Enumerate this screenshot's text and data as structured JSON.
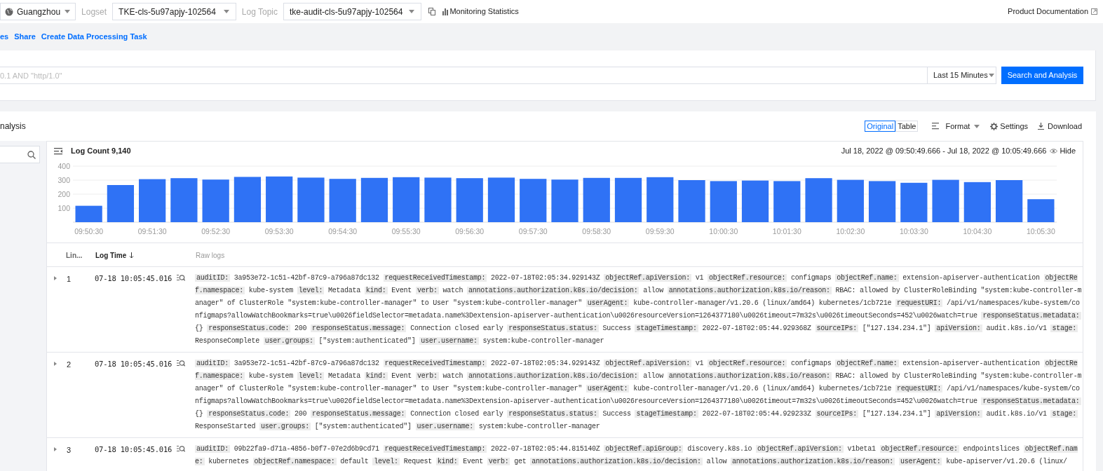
{
  "top_bar": {
    "region": "Guangzhou",
    "logset_label": "Logset",
    "logset": "TKE-cls-5u97apjy-102564",
    "topic_label": "Log Topic",
    "topic": "tke-audit-cls-5u97apjy-102564",
    "monitoring": "Monitoring Statistics",
    "docs": "Product Documentation"
  },
  "actions": [
    "es",
    "Share",
    "Create Data Processing Task"
  ],
  "search": {
    "placeholder": "0.1 AND \"http/1.0\"",
    "time_range": "Last 15 Minutes",
    "button": "Search and Analysis"
  },
  "results": {
    "title": "nalysis",
    "view_tabs": [
      {
        "label": "Original",
        "selected": true
      },
      {
        "label": "Table",
        "selected": false
      }
    ],
    "tools": [
      {
        "kind": "format",
        "label": "Format"
      },
      {
        "kind": "settings",
        "label": "Settings"
      },
      {
        "kind": "download",
        "label": "Download"
      }
    ],
    "log_count": "Log Count 9,140",
    "time_span": "Jul 18, 2022 @ 09:50:49.666 - Jul 18, 2022 @ 10:05:49.666",
    "hide": "Hide",
    "chart_data": {
      "type": "bar",
      "categories": [
        "09:50:30",
        null,
        "09:51:30",
        null,
        "09:52:30",
        null,
        "09:53:30",
        null,
        "09:54:30",
        null,
        "09:55:30",
        null,
        "09:56:30",
        null,
        "09:57:30",
        null,
        "09:58:30",
        null,
        "09:59:30",
        null,
        "10:00:30",
        null,
        "10:01:30",
        null,
        "10:02:30",
        null,
        "10:03:30",
        null,
        "10:04:30",
        null,
        "10:05:30"
      ],
      "series": [
        {
          "color": "#2f72f5",
          "values": [
            117,
            265,
            307,
            314,
            304,
            323,
            326,
            318,
            309,
            316,
            321,
            318,
            314,
            318,
            309,
            304,
            316,
            316,
            321,
            300,
            293,
            297,
            293,
            314,
            302,
            293,
            281,
            302,
            286,
            300,
            164
          ]
        }
      ],
      "ylim": [
        0,
        400
      ],
      "yticks": [
        100,
        200,
        300,
        400
      ],
      "grid": true
    },
    "columns": [
      "Lin...",
      "Log Time",
      "Raw logs"
    ],
    "rows": [
      {
        "number": "1",
        "time": "07-18 10:05:45.016",
        "fields": [
          {
            "key": "auditID:",
            "value": "3a953e72-1c51-42bf-87c9-a796a87dc132"
          },
          {
            "key": "requestReceivedTimestamp:",
            "value": "2022-07-18T02:05:34.929143Z"
          },
          {
            "key": "objectRef.apiVersion:",
            "value": "v1"
          },
          {
            "key": "objectRef.resource:",
            "value": "configmaps"
          },
          {
            "key": "objectRef.name:",
            "value": "extension-apiserver-authentication"
          },
          {
            "key": "objectRef.namespace:",
            "value": "kube-system"
          },
          {
            "key": "level:",
            "value": "Metadata"
          },
          {
            "key": "kind:",
            "value": "Event"
          },
          {
            "key": "verb:",
            "value": "watch"
          },
          {
            "key": "annotations.authorization.k8s.io/decision:",
            "value": "allow"
          },
          {
            "key": "annotations.authorization.k8s.io/reason:",
            "value": "RBAC: allowed by ClusterRoleBinding \"system:kube-controller-manager\" of ClusterRole \"system:kube-controller-manager\" to User \"system:kube-controller-manager\""
          },
          {
            "key": "userAgent:",
            "value": "kube-controller-manager/v1.20.6 (linux/amd64) kubernetes/1cb721e"
          },
          {
            "key": "requestURI:",
            "value": "/api/v1/namespaces/kube-system/configmaps?allowWatchBookmarks=true\\u0026fieldSelector=metadata.name%3Dextension-apiserver-authentication\\u0026resourceVersion=1264377180\\u0026timeout=7m32s\\u0026timeoutSeconds=452\\u0026watch=true"
          },
          {
            "key": "responseStatus.metadata:",
            "value": "{}"
          },
          {
            "key": "responseStatus.code:",
            "value": "200"
          },
          {
            "key": "responseStatus.message:",
            "value": "Connection closed early"
          },
          {
            "key": "responseStatus.status:",
            "value": "Success"
          },
          {
            "key": "stageTimestamp:",
            "value": "2022-07-18T02:05:44.929368Z"
          },
          {
            "key": "sourceIPs:",
            "value": "[\"127.134.234.1\"]"
          },
          {
            "key": "apiVersion:",
            "value": "audit.k8s.io/v1"
          },
          {
            "key": "stage:",
            "value": "ResponseComplete"
          },
          {
            "key": "user.groups:",
            "value": "[\"system:authenticated\"]"
          },
          {
            "key": "user.username:",
            "value": "system:kube-controller-manager"
          }
        ]
      },
      {
        "number": "2",
        "time": "07-18 10:05:45.016",
        "fields": [
          {
            "key": "auditID:",
            "value": "3a953e72-1c51-42bf-87c9-a796a87dc132"
          },
          {
            "key": "requestReceivedTimestamp:",
            "value": "2022-07-18T02:05:34.929143Z"
          },
          {
            "key": "objectRef.apiVersion:",
            "value": "v1"
          },
          {
            "key": "objectRef.resource:",
            "value": "configmaps"
          },
          {
            "key": "objectRef.name:",
            "value": "extension-apiserver-authentication"
          },
          {
            "key": "objectRef.namespace:",
            "value": "kube-system"
          },
          {
            "key": "level:",
            "value": "Metadata"
          },
          {
            "key": "kind:",
            "value": "Event"
          },
          {
            "key": "verb:",
            "value": "watch"
          },
          {
            "key": "annotations.authorization.k8s.io/decision:",
            "value": "allow"
          },
          {
            "key": "annotations.authorization.k8s.io/reason:",
            "value": "RBAC: allowed by ClusterRoleBinding \"system:kube-controller-manager\" of ClusterRole \"system:kube-controller-manager\" to User \"system:kube-controller-manager\""
          },
          {
            "key": "userAgent:",
            "value": "kube-controller-manager/v1.20.6 (linux/amd64) kubernetes/1cb721e"
          },
          {
            "key": "requestURI:",
            "value": "/api/v1/namespaces/kube-system/configmaps?allowWatchBookmarks=true\\u0026fieldSelector=metadata.name%3Dextension-apiserver-authentication\\u0026resourceVersion=1264377180\\u0026timeout=7m32s\\u0026timeoutSeconds=452\\u0026watch=true"
          },
          {
            "key": "responseStatus.metadata:",
            "value": "{}"
          },
          {
            "key": "responseStatus.code:",
            "value": "200"
          },
          {
            "key": "responseStatus.message:",
            "value": "Connection closed early"
          },
          {
            "key": "responseStatus.status:",
            "value": "Success"
          },
          {
            "key": "stageTimestamp:",
            "value": "2022-07-18T02:05:44.929233Z"
          },
          {
            "key": "sourceIPs:",
            "value": "[\"127.134.234.1\"]"
          },
          {
            "key": "apiVersion:",
            "value": "audit.k8s.io/v1"
          },
          {
            "key": "stage:",
            "value": "ResponseStarted"
          },
          {
            "key": "user.groups:",
            "value": "[\"system:authenticated\"]"
          },
          {
            "key": "user.username:",
            "value": "system:kube-controller-manager"
          }
        ]
      },
      {
        "number": "3",
        "time": "07-18 10:05:45.016",
        "fields": [
          {
            "key": "auditID:",
            "value": "09b22fa9-d71a-4856-b0f7-07e2d6b9cd71"
          },
          {
            "key": "requestReceivedTimestamp:",
            "value": "2022-07-18T02:05:44.815140Z"
          },
          {
            "key": "objectRef.apiGroup:",
            "value": "discovery.k8s.io"
          },
          {
            "key": "objectRef.apiVersion:",
            "value": "v1beta1"
          },
          {
            "key": "objectRef.resource:",
            "value": "endpointslices"
          },
          {
            "key": "objectRef.name:",
            "value": "kubernetes"
          },
          {
            "key": "objectRef.namespace:",
            "value": "default"
          },
          {
            "key": "level:",
            "value": "Request"
          },
          {
            "key": "kind:",
            "value": "Event"
          },
          {
            "key": "verb:",
            "value": "get"
          },
          {
            "key": "annotations.authorization.k8s.io/decision:",
            "value": "allow"
          },
          {
            "key": "annotations.authorization.k8s.io/reason:"
          },
          {
            "key": "userAgent:",
            "value": "kube-apiserver/v1.20.6 (linux/"
          }
        ]
      }
    ]
  }
}
